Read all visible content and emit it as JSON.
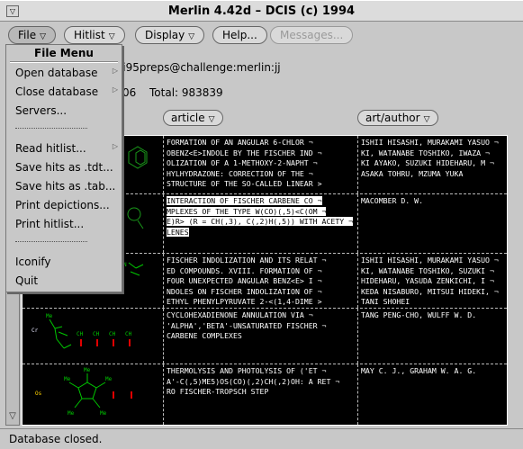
{
  "window": {
    "title": "Merlin 4.42d – DCIS (c) 1994"
  },
  "menubar": {
    "file": "File",
    "hitlist": "Hitlist",
    "display": "Display",
    "help": "Help...",
    "messages": "Messages..."
  },
  "info": {
    "server": "si95preps@challenge:merlin:jj",
    "hits": "06",
    "total": "Total: 983839"
  },
  "columns": {
    "article": "article",
    "author": "art/author"
  },
  "rows": [
    {
      "title": "FORMATION OF AN ANGULAR 6-CHLOR ¬\nOBENZ<E>INDOLE BY THE FISCHER IND ¬\nOLIZATION OF A 1-METHOXY-2-NAPHT ¬\nHYLHYDRAZONE: CORRECTION OF THE ¬\nSTRUCTURE OF THE SO-CALLED LINEAR >",
      "author": "ISHII HISASHI, MURAKAMI YASUO ¬\nKI, WATANABE TOSHIKO, IWAZA ¬\nKI AYAKO, SUZUKI HIDEHARU, M ¬\nASAKA TOHRU, MZUMA YUKA"
    },
    {
      "title": "INTERACTION OF FISCHER CARBENE CO ¬\nMPLEXES OF THE TYPE W(CO)(,5)<C(OM ¬\nE)R> (R = CH(,3), C(,2)H(,5)) WITH ACETY ¬\nLENES",
      "author": "MACOMBER D. W."
    },
    {
      "title": "FISCHER INDOLIZATION AND ITS RELAT ¬\nED COMPOUNDS. XVIII. FORMATION OF ¬\nFOUR UNEXPECTED ANGULAR BENZ<E> I ¬\nNDOLES ON FISCHER INDOLIZATION OF ¬\nETHYL PHENYLPYRUVATE 2-<(1,4-DIME >",
      "author": "ISHII HISASHI, MURAKAMI YASUO ¬\nKI, WATANABE TOSHIKO, SUZUKI ¬\nHIDEHARU, YASUDA ZENKICHI, I ¬\nKEDA NISABURO, MITSUI HIDEKI, ¬\nTANI SHOHEI"
    },
    {
      "title": "CYCLOHEXADIENONE ANNULATION VIA ¬\n'ALPHA','BETA'-UNSATURATED FISCHER ¬\nCARBENE COMPLEXES",
      "author": "TANG PENG-CHO, WULFF W. D."
    },
    {
      "title": "THERMOLYSIS AND PHOTOLYSIS OF ('ET ¬\nA'-C(,5)ME5)OS(CO)(,2)CH(,2)OH: A RET ¬\nRO FISCHER-TROPSCH STEP",
      "author": "MAY C. J., GRAHAM W. A. G."
    }
  ],
  "status": "Database closed.",
  "file_menu": {
    "header": "File Menu",
    "items": [
      "Open database",
      "Close database",
      "Servers...",
      "Read hitlist...",
      "Save hits as .tdt...",
      "Save hits as .tab...",
      "Print depictions...",
      "Print hitlist...",
      "Iconify",
      "Quit"
    ]
  },
  "colors": {
    "table_bg": "#000000",
    "window_bg": "#c8c8c8",
    "green_atoms": "#00c800",
    "red_atoms": "#e00000"
  }
}
